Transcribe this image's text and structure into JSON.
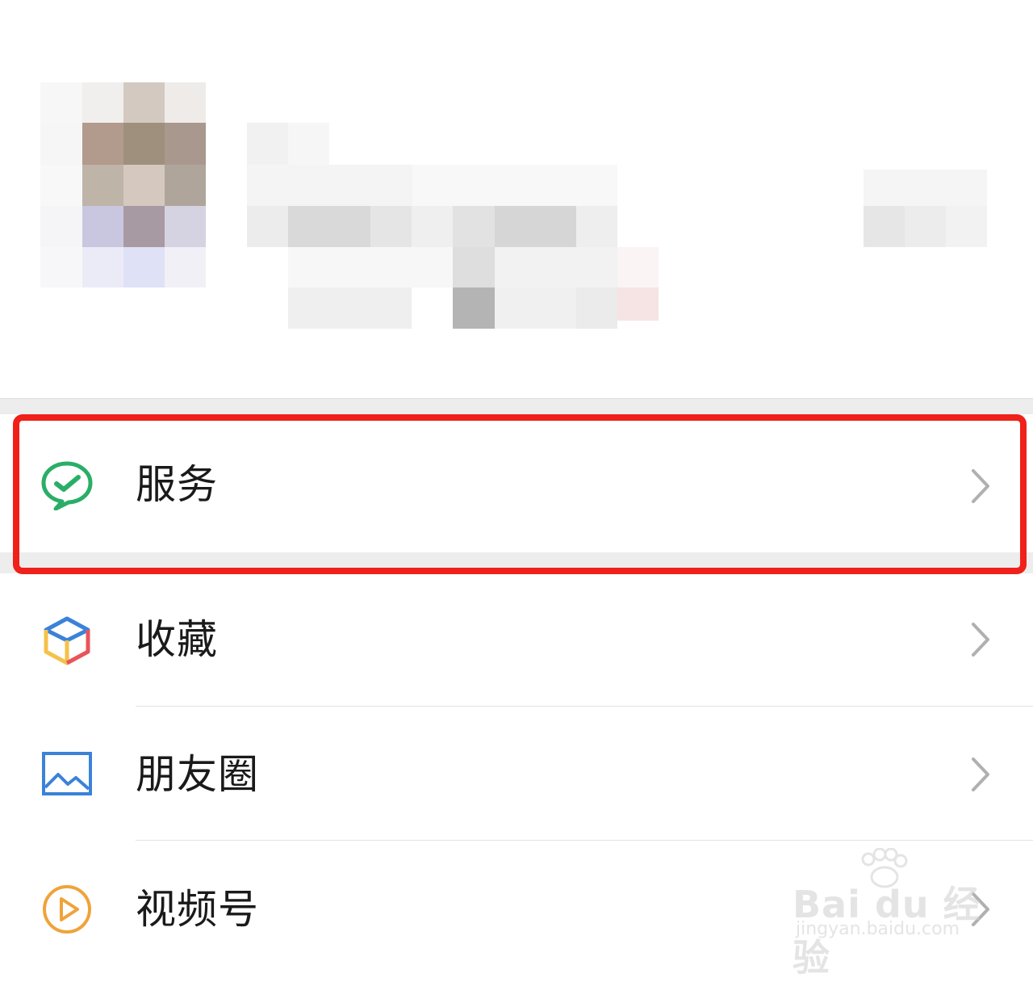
{
  "menu": {
    "items": [
      {
        "label": "服务",
        "icon": "wechat-pay-icon"
      },
      {
        "label": "收藏",
        "icon": "favorites-cube-icon"
      },
      {
        "label": "朋友圈",
        "icon": "moments-picture-icon"
      },
      {
        "label": "视频号",
        "icon": "channels-play-icon"
      }
    ]
  },
  "annotation": {
    "color": "#f0201a",
    "target": "服务"
  },
  "watermark": {
    "brand": "Bai du 经验",
    "url": "jingyan.baidu.com"
  },
  "colors": {
    "wechat_green": "#2aae67",
    "moments_blue": "#3b82d8",
    "channels_orange": "#f0a33a"
  }
}
